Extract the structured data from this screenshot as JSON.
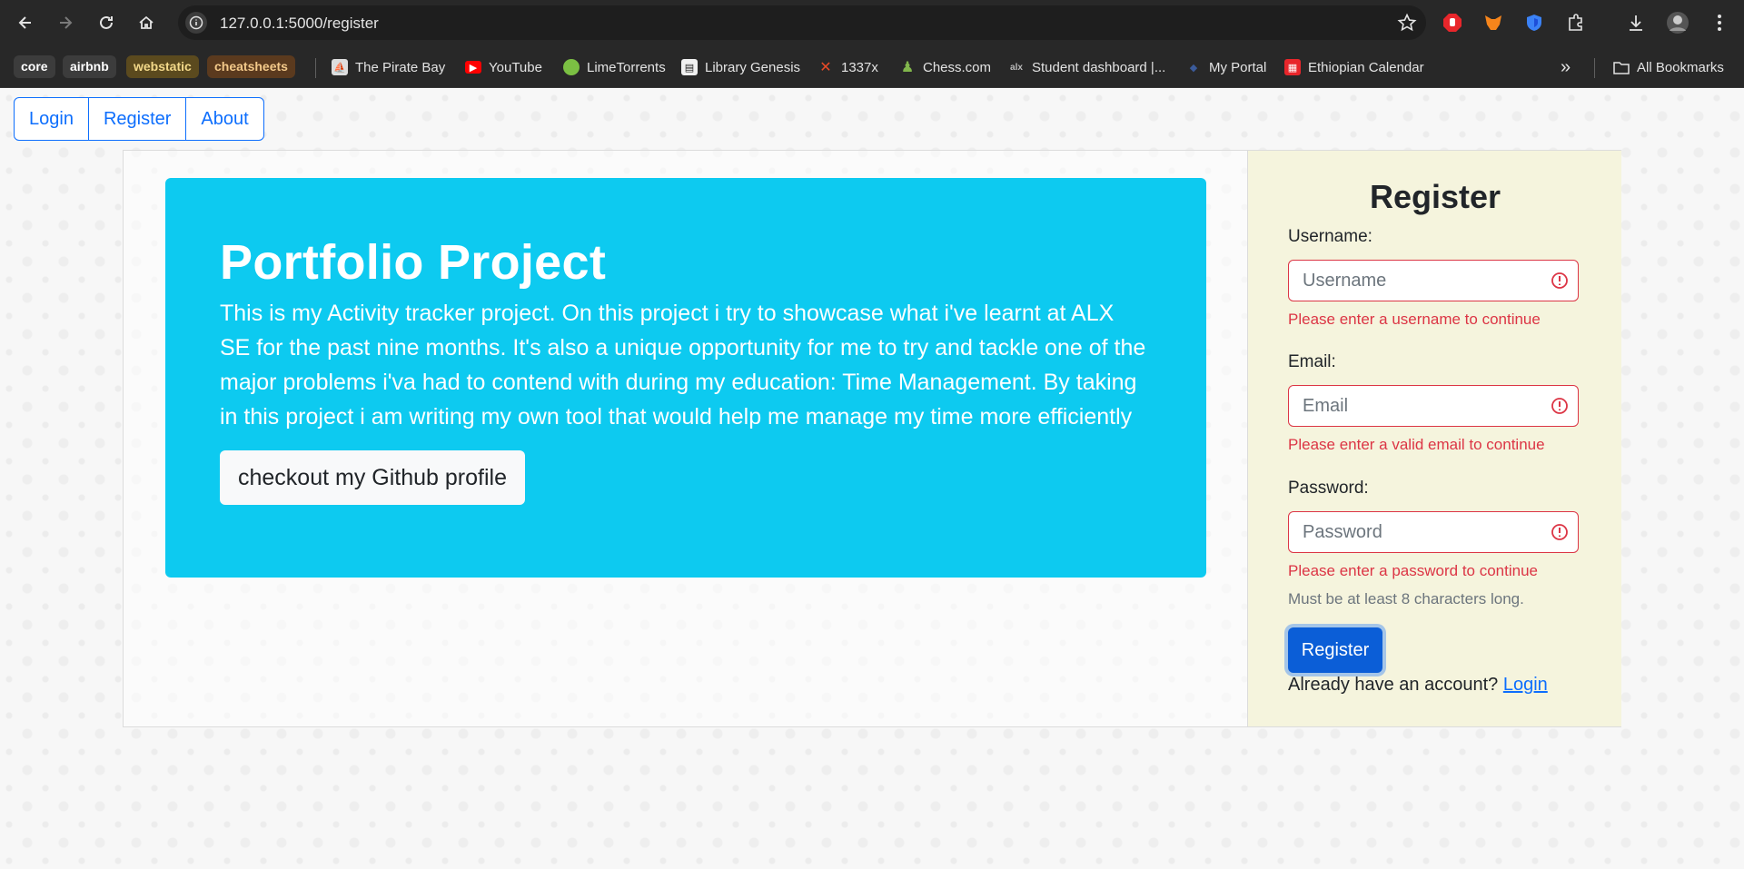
{
  "browser": {
    "url": "127.0.0.1:5000/register",
    "bookmark_chips": [
      {
        "label": "core",
        "bg": "#3c3c3c",
        "color": "#ffffff"
      },
      {
        "label": "airbnb",
        "bg": "#3c3c3c",
        "color": "#ffffff"
      },
      {
        "label": "webstatic",
        "bg": "#5b4a1e",
        "color": "#f3d98a"
      },
      {
        "label": "cheatsheets",
        "bg": "#5b3a1e",
        "color": "#f3c98a"
      }
    ],
    "bookmarks": [
      "The Pirate Bay",
      "YouTube",
      "LimeTorrents",
      "Library Genesis",
      "1337x",
      "Chess.com",
      "Student dashboard |...",
      "My Portal",
      "Ethiopian Calendar"
    ],
    "overflow_label": "»",
    "all_bookmarks_label": "All Bookmarks"
  },
  "nav": {
    "login": "Login",
    "register": "Register",
    "about": "About"
  },
  "hero": {
    "title": "Portfolio Project",
    "text": "This is my Activity tracker project. On this project i try to showcase what i've learnt at ALX SE for the past nine months. It's also a unique opportunity for me to try and tackle one of the major problems i'va had to contend with during my education: Time Management. By taking in this project i am writing my own tool that would help me manage my time more efficiently",
    "button": "checkout my Github profile"
  },
  "register": {
    "title": "Register",
    "username_label": "Username:",
    "username_placeholder": "Username",
    "username_error": "Please enter a username to continue",
    "email_label": "Email:",
    "email_placeholder": "Email",
    "email_error": "Please enter a valid email to continue",
    "password_label": "Password:",
    "password_placeholder": "Password",
    "password_error": "Please enter a password to continue",
    "password_hint": "Must be at least 8 characters long.",
    "submit": "Register",
    "have_account": "Already have an account?",
    "login_link": "Login"
  },
  "colors": {
    "hero_bg": "#0dcaf0",
    "side_bg": "#f5f4dd",
    "primary": "#0d6efd",
    "danger": "#dc3545"
  }
}
